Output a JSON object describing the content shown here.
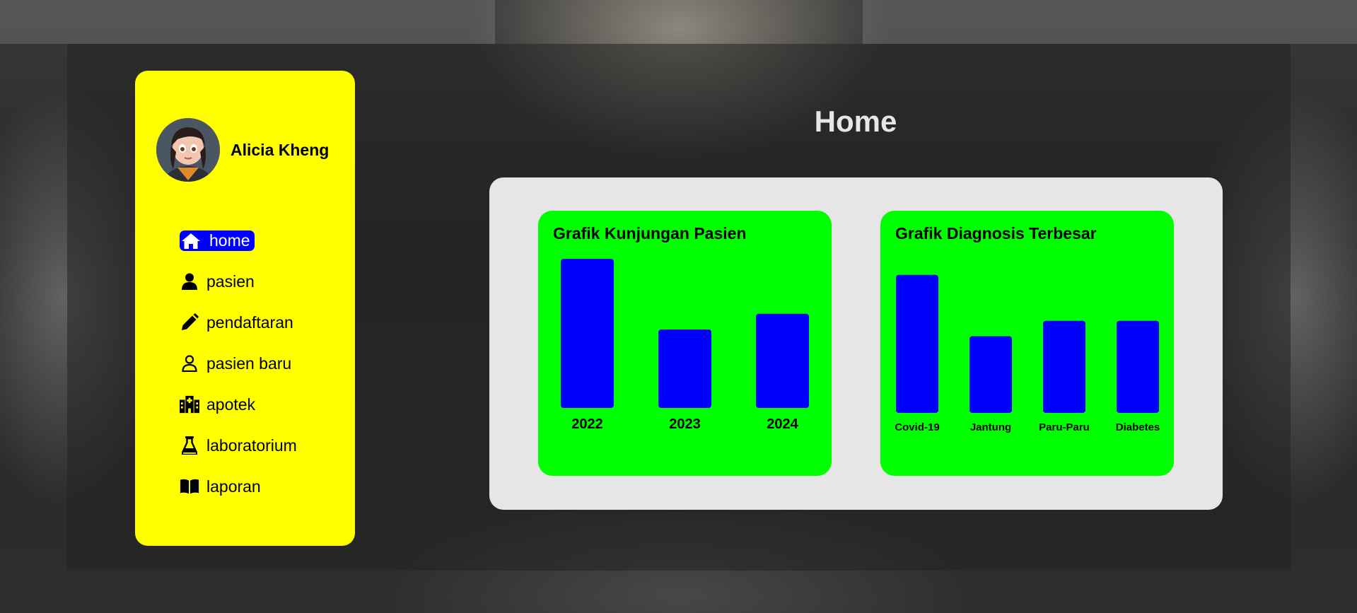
{
  "user": {
    "name": "Alicia Kheng"
  },
  "nav": [
    {
      "label": "home",
      "icon": "home-icon",
      "active": true
    },
    {
      "label": "pasien",
      "icon": "user-icon"
    },
    {
      "label": "pendaftaran",
      "icon": "pencil-icon"
    },
    {
      "label": "pasien baru",
      "icon": "user-outline-icon"
    },
    {
      "label": "apotek",
      "icon": "hospital-icon"
    },
    {
      "label": "laboratorium",
      "icon": "flask-icon"
    },
    {
      "label": "laporan",
      "icon": "book-icon"
    }
  ],
  "page": {
    "title": "Home"
  },
  "colors": {
    "sidebar": "#ffff00",
    "active_nav": "#0000ff",
    "chart_card": "#00ff00",
    "bar": "#0000ff",
    "content_card": "#e6e6e6"
  },
  "chart_data": [
    {
      "type": "bar",
      "title": "Grafik Kunjungan Pasien",
      "categories": [
        "2022",
        "2023",
        "2024"
      ],
      "values": [
        95,
        50,
        60
      ],
      "ylim": [
        0,
        100
      ],
      "grid": false
    },
    {
      "type": "bar",
      "title": "Grafik Diagnosis Terbesar",
      "categories": [
        "Covid-19",
        "Jantung",
        "Paru-Paru",
        "Diabetes"
      ],
      "values": [
        90,
        50,
        60,
        60
      ],
      "ylim": [
        0,
        100
      ],
      "grid": false
    }
  ]
}
